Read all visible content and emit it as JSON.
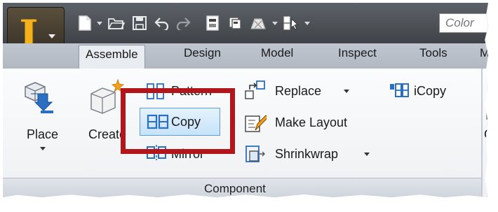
{
  "quick_access": {
    "app_button_letter": "I",
    "color_box_text": "Color"
  },
  "tabs": [
    {
      "label": "Assemble",
      "active": true
    },
    {
      "label": "Design"
    },
    {
      "label": "Model"
    },
    {
      "label": "Inspect"
    },
    {
      "label": "Tools"
    },
    {
      "label": "M"
    }
  ],
  "ribbon": {
    "place_label": "Place",
    "create_label": "Create",
    "pattern_label": "Pattern",
    "copy_label": "Copy",
    "mirror_label": "Mirror",
    "replace_label": "Replace",
    "make_layout_label": "Make Layout",
    "shrinkwrap_label": "Shrinkwrap",
    "icopy_label": "iCopy",
    "next_group_label": "Co",
    "group_label": "Component"
  },
  "colors": {
    "highlight_frame": "#b3161a",
    "copy_button_fill": "#c7e3f9",
    "icon_blue": "#2b6fc2",
    "app_letter": "#f3b21c"
  },
  "icons": [
    "new-file-icon",
    "open-folder-icon",
    "save-icon",
    "undo-icon",
    "redo-icon",
    "project-icon",
    "copy-design-icon",
    "appearance-icon",
    "select-priority-icon",
    "place-icon",
    "create-icon",
    "pattern-icon",
    "copy-icon",
    "mirror-icon",
    "replace-icon",
    "make-layout-icon",
    "shrinkwrap-icon",
    "icopy-icon"
  ]
}
